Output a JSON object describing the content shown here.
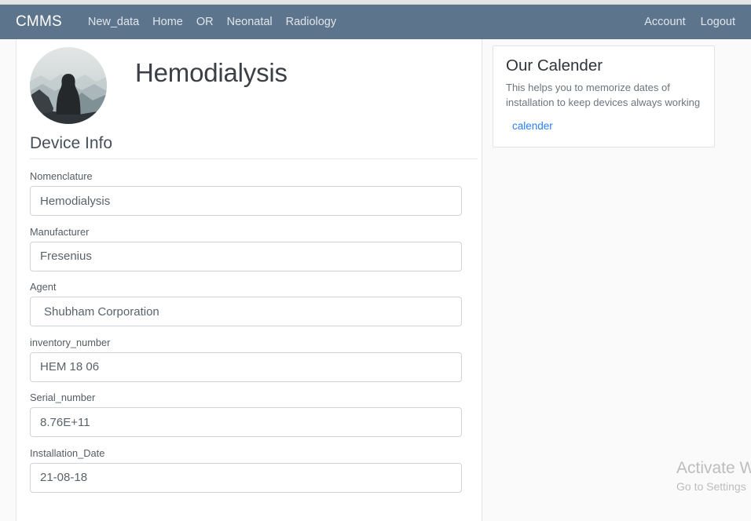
{
  "navbar": {
    "brand": "CMMS",
    "links": [
      {
        "label": "New_data"
      },
      {
        "label": "Home"
      },
      {
        "label": "OR"
      },
      {
        "label": "Neonatal"
      },
      {
        "label": "Radiology"
      }
    ],
    "right_links": [
      {
        "label": "Account"
      },
      {
        "label": "Logout"
      }
    ],
    "background_color": "#5d758c"
  },
  "main": {
    "avatar_alt": "mountain-silhouette-avatar",
    "page_title": "Hemodialysis",
    "section_heading": "Device Info",
    "fields": [
      {
        "label": "Nomenclature",
        "value": "Hemodialysis"
      },
      {
        "label": "Manufacturer",
        "value": "Fresenius"
      },
      {
        "label": "Agent",
        "value": "Shubham Corporation"
      },
      {
        "label": "inventory_number",
        "value": "HEM 18 06"
      },
      {
        "label": "Serial_number",
        "value": "8.76E+11"
      },
      {
        "label": "Installation_Date",
        "value": "21-08-18"
      }
    ]
  },
  "sidebar": {
    "calendar_card": {
      "title": "Our Calender",
      "description": "This helps you to memorize dates of installation to keep devices always working",
      "link_label": "calender",
      "link_color": "#2a7fff"
    }
  },
  "watermark": {
    "title": "Activate W",
    "subtitle": "Go to Settings"
  }
}
